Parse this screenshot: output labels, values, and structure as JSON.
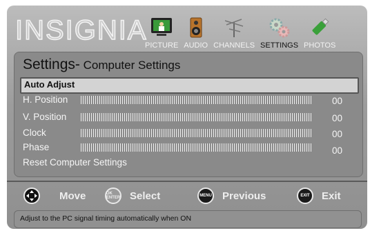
{
  "brand": "INSIGNIA",
  "tabs": [
    {
      "label": "PICTURE",
      "icon": "tv-icon",
      "active": false
    },
    {
      "label": "AUDIO",
      "icon": "speaker-icon",
      "active": false
    },
    {
      "label": "CHANNELS",
      "icon": "antenna-icon",
      "active": false
    },
    {
      "label": "SETTINGS",
      "icon": "gears-icon",
      "active": true
    },
    {
      "label": "PHOTOS",
      "icon": "usb-drive-icon",
      "active": false
    }
  ],
  "panel": {
    "title": "Settings-",
    "subtitle": " Computer Settings",
    "selected_item": "Auto Adjust",
    "items": [
      {
        "label": "H. Position",
        "value": "00"
      },
      {
        "label": "V. Position",
        "value": "00"
      },
      {
        "label": "Clock",
        "value": "00"
      },
      {
        "label": "Phase",
        "value": "00"
      }
    ],
    "reset_label": "Reset Computer Settings"
  },
  "nav": [
    {
      "label": "Move",
      "icon": "move-arrows-icon"
    },
    {
      "label": "Select",
      "icon": "ok-enter-icon",
      "icon_text": "OK ENTER"
    },
    {
      "label": "Previous",
      "icon": "menu-button-icon",
      "icon_text": "MENU"
    },
    {
      "label": "Exit",
      "icon": "exit-button-icon",
      "icon_text": "EXIT"
    }
  ],
  "status_text": "Adjust to the PC signal timing automatically when ON"
}
